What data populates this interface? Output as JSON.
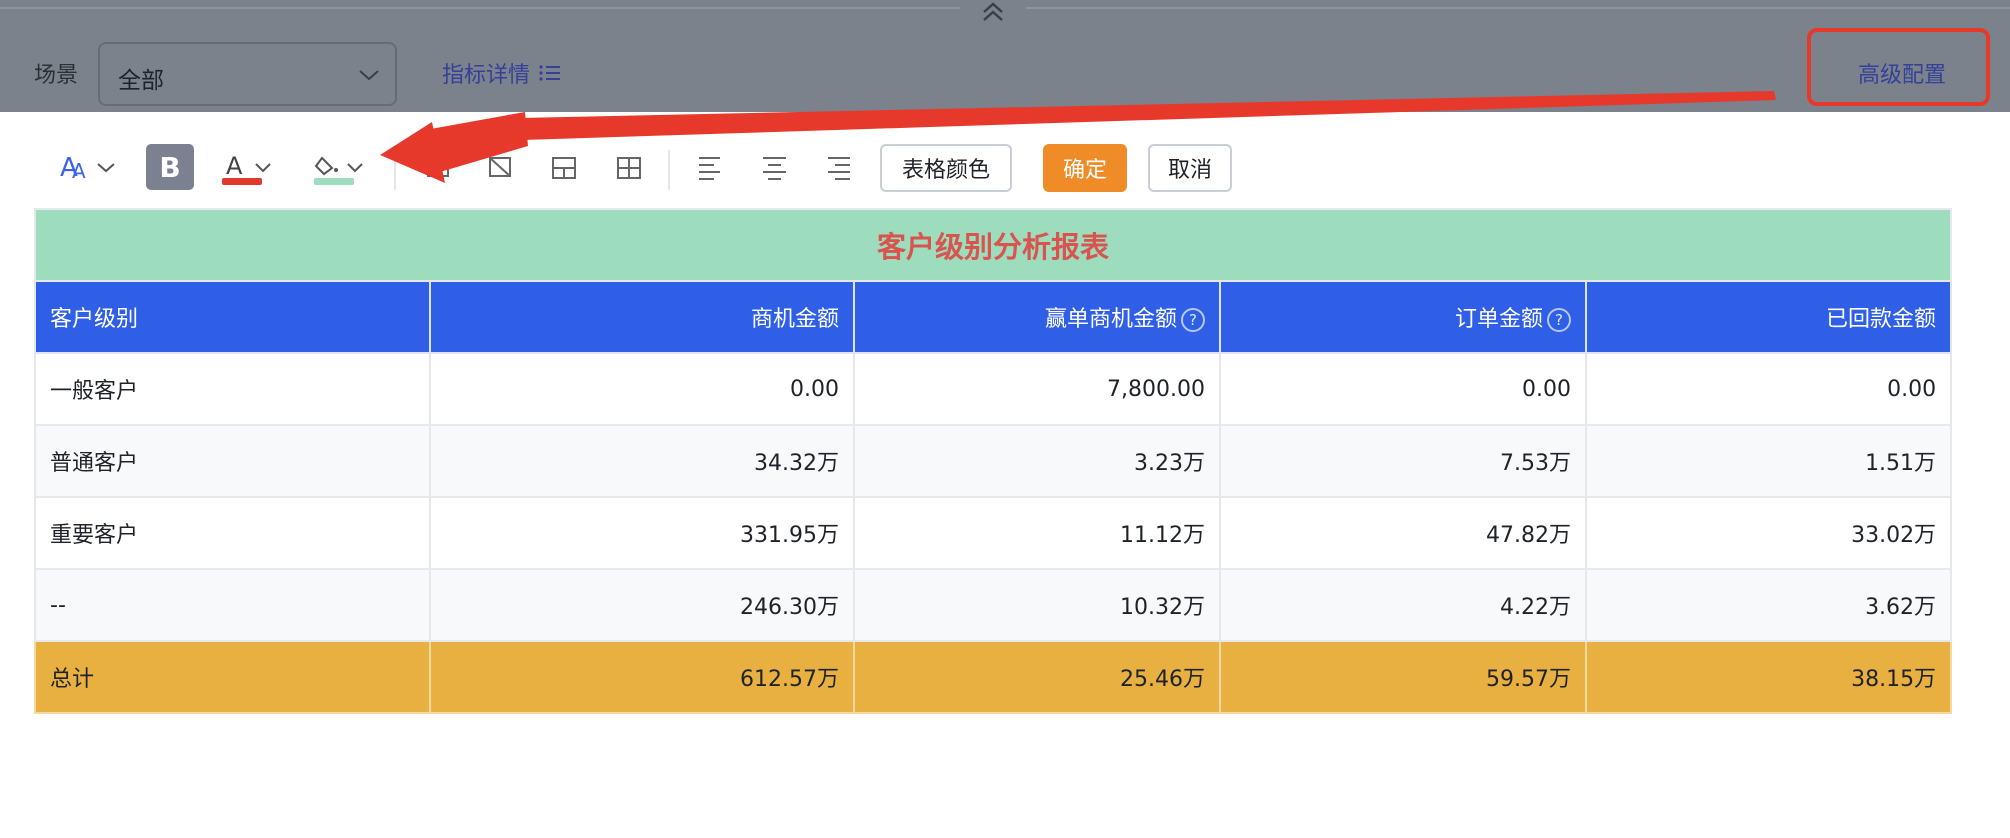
{
  "filter": {
    "scene_label": "场景",
    "scene_value": "全部",
    "metric_link": "指标详情",
    "advanced_link": "高级配置"
  },
  "toolbar": {
    "table_color_label": "表格颜色",
    "confirm_label": "确定",
    "cancel_label": "取消",
    "bold_glyph": "B",
    "font_color": "#e03a2f",
    "fill_color": "#9ddcbd"
  },
  "colors": {
    "title_bg": "#9ddcbd",
    "title_text": "#d9534f",
    "header_bg": "#2f5fe6",
    "total_bg": "#e8b040",
    "confirm_bg": "#f08c28",
    "annotation": "#e6392c"
  },
  "table": {
    "title": "客户级别分析报表",
    "headers": [
      "客户级别",
      "商机金额",
      "赢单商机金额",
      "订单金额",
      "已回款金额"
    ],
    "rows": [
      [
        "一般客户",
        "0.00",
        "7,800.00",
        "0.00",
        "0.00"
      ],
      [
        "普通客户",
        "34.32万",
        "3.23万",
        "7.53万",
        "1.51万"
      ],
      [
        "重要客户",
        "331.95万",
        "11.12万",
        "47.82万",
        "33.02万"
      ],
      [
        "--",
        "246.30万",
        "10.32万",
        "4.22万",
        "3.62万"
      ]
    ],
    "total": [
      "总计",
      "612.57万",
      "25.46万",
      "59.57万",
      "38.15万"
    ]
  }
}
